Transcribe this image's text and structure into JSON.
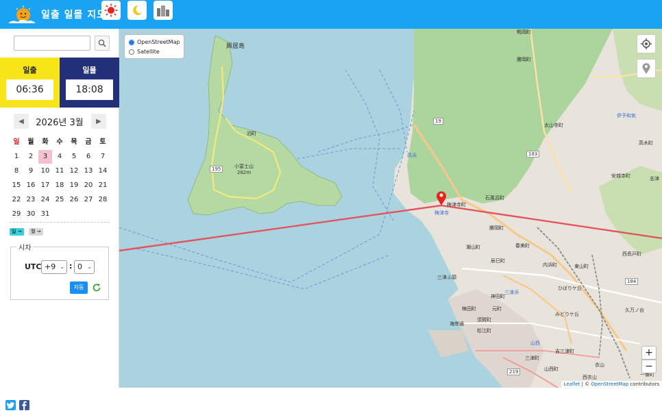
{
  "header": {
    "title": "일출 일몰 지도",
    "buttons": [
      {
        "name": "sun-mode-button",
        "icon": "sun-icon"
      },
      {
        "name": "moon-mode-button",
        "icon": "moon-icon"
      },
      {
        "name": "city-mode-button",
        "icon": "buildings-icon"
      }
    ]
  },
  "search": {
    "value": "",
    "placeholder": "",
    "icon": "search-icon"
  },
  "sunrise": {
    "label": "일출",
    "time": "06:36",
    "color": "#f7e51a"
  },
  "sunset": {
    "label": "일몰",
    "time": "18:08",
    "color": "#22317a"
  },
  "calendar": {
    "title": "2026년 3월",
    "prev_icon": "triangle-left-icon",
    "next_icon": "triangle-right-icon",
    "weekdays": [
      "일",
      "월",
      "화",
      "수",
      "목",
      "금",
      "토"
    ],
    "days": [
      [
        "1",
        "2",
        "3",
        "4",
        "5",
        "6",
        "7"
      ],
      [
        "8",
        "9",
        "10",
        "11",
        "12",
        "13",
        "14"
      ],
      [
        "15",
        "16",
        "17",
        "18",
        "19",
        "20",
        "21"
      ],
      [
        "22",
        "23",
        "24",
        "25",
        "26",
        "27",
        "28"
      ],
      [
        "29",
        "30",
        "31",
        "",
        "",
        "",
        ""
      ]
    ],
    "selected_day": "3"
  },
  "chips": [
    {
      "label": "일 →",
      "color": "#39d0d8"
    },
    {
      "label": "월 →",
      "color": "#d9d9d9"
    }
  ],
  "timezone": {
    "legend": "시차",
    "utc_label": "UTC",
    "hour_offset": "+9",
    "minute_offset": "0",
    "separator": ":",
    "auto_label": "자동",
    "refresh_icon": "refresh-icon"
  },
  "social": [
    {
      "name": "twitter-button",
      "icon": "twitter-icon",
      "color": "#1da1f2"
    },
    {
      "name": "facebook-button",
      "icon": "facebook-icon",
      "color": "#3b5998"
    }
  ],
  "map": {
    "layers": [
      {
        "label": "OpenStreetMap",
        "selected": true
      },
      {
        "label": "Satellite",
        "selected": false
      }
    ],
    "locate_icon": "crosshair-icon",
    "marker_button_icon": "map-pin-icon",
    "zoom_in": "+",
    "zoom_out": "−",
    "attribution_leaflet": "Leaflet",
    "attribution_sep": " | © ",
    "attribution_osm": "OpenStreetMap",
    "attribution_rest": " contributors",
    "marker_icon": "map-pin-icon",
    "places": [
      {
        "text": "興居島"
      },
      {
        "text": "泊町"
      },
      {
        "text": "小富士山"
      },
      {
        "text": "282m"
      },
      {
        "text": "梅津寺町"
      },
      {
        "text": "梅津寺"
      },
      {
        "text": "高浜"
      },
      {
        "text": "石風呂町"
      },
      {
        "text": "太山寺町"
      },
      {
        "text": "勝岡町"
      },
      {
        "text": "春美町"
      },
      {
        "text": "潮山町"
      },
      {
        "text": "辰巳町"
      },
      {
        "text": "内浜町"
      },
      {
        "text": "東山町"
      },
      {
        "text": "三津ふ頭"
      },
      {
        "text": "三津浜"
      },
      {
        "text": "神田町"
      },
      {
        "text": "梅田町"
      },
      {
        "text": "元町"
      },
      {
        "text": "須賀町"
      },
      {
        "text": "松江町"
      },
      {
        "text": "海岸通"
      },
      {
        "text": "ひばりケ丘"
      },
      {
        "text": "みどりケ丘"
      },
      {
        "text": "久万ノ台"
      },
      {
        "text": "西長戸町"
      },
      {
        "text": "安城寺町"
      },
      {
        "text": "高木町"
      },
      {
        "text": "志津"
      },
      {
        "text": "伊予和気"
      },
      {
        "text": "吉三津町"
      },
      {
        "text": "山西町"
      },
      {
        "text": "西衣山"
      },
      {
        "text": "衣山"
      },
      {
        "text": "勝岡町"
      },
      {
        "text": "鴨岡町"
      },
      {
        "text": "一番町"
      },
      {
        "text": "山西"
      },
      {
        "text": "三津町"
      }
    ],
    "route_labels": [
      "195",
      "19",
      "183",
      "184",
      "219"
    ]
  }
}
